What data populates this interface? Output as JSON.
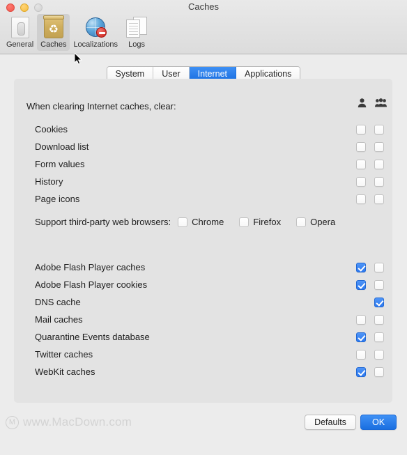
{
  "window": {
    "title": "Caches",
    "traffic_lights": [
      "close",
      "minimize",
      "zoom-disabled"
    ]
  },
  "toolbar": {
    "items": [
      {
        "label": "General",
        "icon": "document-icon",
        "selected": false
      },
      {
        "label": "Caches",
        "icon": "trash-recycle-icon",
        "selected": true
      },
      {
        "label": "Localizations",
        "icon": "globe-blocked-icon",
        "selected": false
      },
      {
        "label": "Logs",
        "icon": "pages-icon",
        "selected": false
      }
    ]
  },
  "tabs": {
    "items": [
      {
        "label": "System",
        "active": false
      },
      {
        "label": "User",
        "active": false
      },
      {
        "label": "Internet",
        "active": true
      },
      {
        "label": "Applications",
        "active": false
      }
    ]
  },
  "panel": {
    "section_title": "When clearing Internet caches, clear:",
    "column_headers": [
      {
        "name": "current-user-column",
        "icon": "single-person-icon"
      },
      {
        "name": "all-users-column",
        "icon": "group-people-icon"
      }
    ],
    "group_one": [
      {
        "label": "Cookies",
        "user": false,
        "all": false,
        "has_user": true,
        "has_all": true
      },
      {
        "label": "Download list",
        "user": false,
        "all": false,
        "has_user": true,
        "has_all": true
      },
      {
        "label": "Form values",
        "user": false,
        "all": false,
        "has_user": true,
        "has_all": true
      },
      {
        "label": "History",
        "user": false,
        "all": false,
        "has_user": true,
        "has_all": true
      },
      {
        "label": "Page icons",
        "user": false,
        "all": false,
        "has_user": true,
        "has_all": true
      }
    ],
    "browsers": {
      "label": "Support third-party web browsers:",
      "options": [
        {
          "label": "Chrome",
          "checked": false
        },
        {
          "label": "Firefox",
          "checked": false
        },
        {
          "label": "Opera",
          "checked": false
        }
      ]
    },
    "group_two": [
      {
        "label": "Adobe Flash Player caches",
        "user": true,
        "all": false,
        "has_user": true,
        "has_all": true
      },
      {
        "label": "Adobe Flash Player cookies",
        "user": true,
        "all": false,
        "has_user": true,
        "has_all": true
      },
      {
        "label": "DNS cache",
        "user": false,
        "all": true,
        "has_user": false,
        "has_all": true
      },
      {
        "label": "Mail caches",
        "user": false,
        "all": false,
        "has_user": true,
        "has_all": true
      },
      {
        "label": "Quarantine Events database",
        "user": true,
        "all": false,
        "has_user": true,
        "has_all": true
      },
      {
        "label": "Twitter caches",
        "user": false,
        "all": false,
        "has_user": true,
        "has_all": true
      },
      {
        "label": "WebKit caches",
        "user": true,
        "all": false,
        "has_user": true,
        "has_all": true
      }
    ]
  },
  "footer": {
    "defaults_label": "Defaults",
    "ok_label": "OK",
    "watermark_text": "www.MacDown.com"
  },
  "colors": {
    "accent_blue": "#2d79ef",
    "window_bg": "#ececec",
    "panel_bg": "#e3e3e3"
  }
}
